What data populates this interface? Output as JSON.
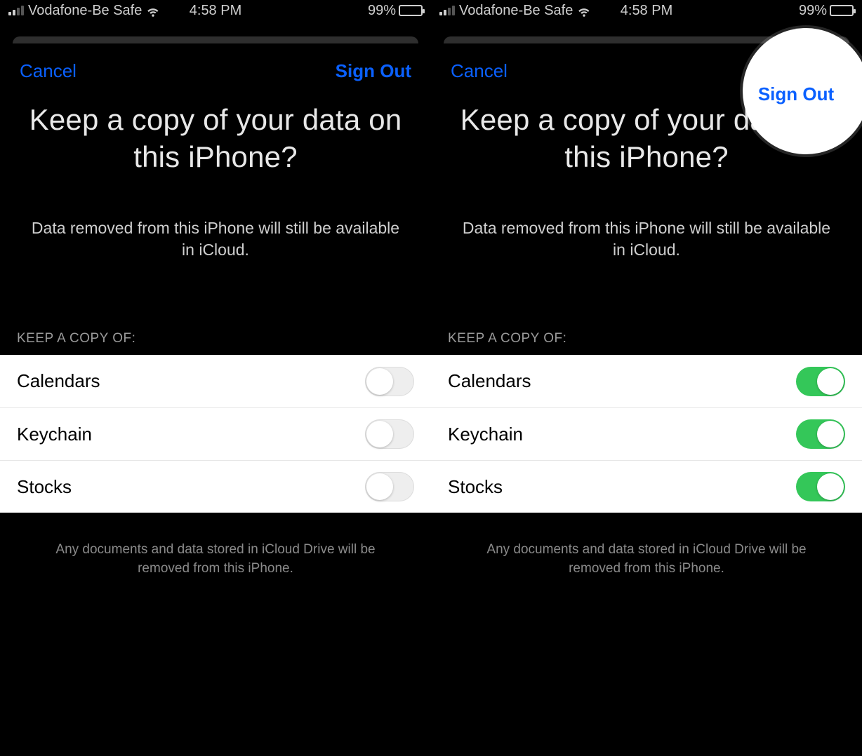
{
  "status": {
    "carrier": "Vodafone-Be Safe",
    "time": "4:58 PM",
    "battery_pct": "99%"
  },
  "nav": {
    "cancel": "Cancel",
    "sign_out": "Sign Out"
  },
  "prompt": {
    "heading": "Keep a copy of your data on this iPhone?",
    "sub": "Data removed from this iPhone will still be available in iCloud."
  },
  "section": {
    "keep_copy_header": "KEEP A COPY OF:"
  },
  "left": {
    "items": [
      {
        "label": "Calendars",
        "on": false
      },
      {
        "label": "Keychain",
        "on": false
      },
      {
        "label": "Stocks",
        "on": false
      }
    ]
  },
  "right": {
    "items": [
      {
        "label": "Calendars",
        "on": true
      },
      {
        "label": "Keychain",
        "on": true
      },
      {
        "label": "Stocks",
        "on": true
      }
    ]
  },
  "footer": {
    "note": "Any documents and data stored in iCloud Drive will be removed from this iPhone."
  },
  "highlight": {
    "label": "Sign Out"
  },
  "colors": {
    "ios_blue": "#0a60ff",
    "switch_green": "#34c759"
  }
}
